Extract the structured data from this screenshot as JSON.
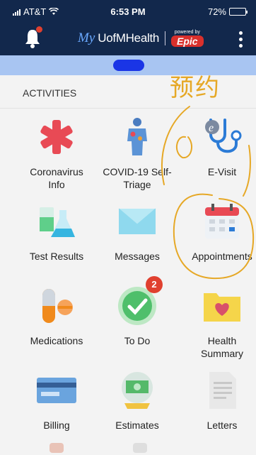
{
  "status_bar": {
    "carrier": "AT&T",
    "time": "6:53 PM",
    "battery": "72%",
    "battery_level": 0.72
  },
  "header": {
    "brand_prefix": "My",
    "brand_name": "UofMHealth",
    "powered_by": "powered by",
    "epic": "Epic"
  },
  "section": {
    "title": "ACTIVITIES"
  },
  "annotation": {
    "text": "预约"
  },
  "activities": [
    {
      "label": "Coronavirus Info",
      "icon": "medical-cross-icon"
    },
    {
      "label": "COVID-19 Self-Triage",
      "icon": "body-scan-icon"
    },
    {
      "label": "E-Visit",
      "icon": "stethoscope-icon"
    },
    {
      "label": "Test Results",
      "icon": "lab-flask-icon"
    },
    {
      "label": "Messages",
      "icon": "envelope-icon"
    },
    {
      "label": "Appointments",
      "icon": "calendar-icon"
    },
    {
      "label": "Medications",
      "icon": "pill-icon"
    },
    {
      "label": "To Do",
      "icon": "checkmark-icon",
      "badge": "2"
    },
    {
      "label": "Health Summary",
      "icon": "folder-heart-icon"
    },
    {
      "label": "Billing",
      "icon": "credit-card-icon"
    },
    {
      "label": "Estimates",
      "icon": "money-estimate-icon"
    },
    {
      "label": "Letters",
      "icon": "letter-document-icon"
    }
  ],
  "colors": {
    "header": "#12284c",
    "banner": "#a8c5f2",
    "annotation": "#e6a826",
    "badge": "#e0402f"
  }
}
